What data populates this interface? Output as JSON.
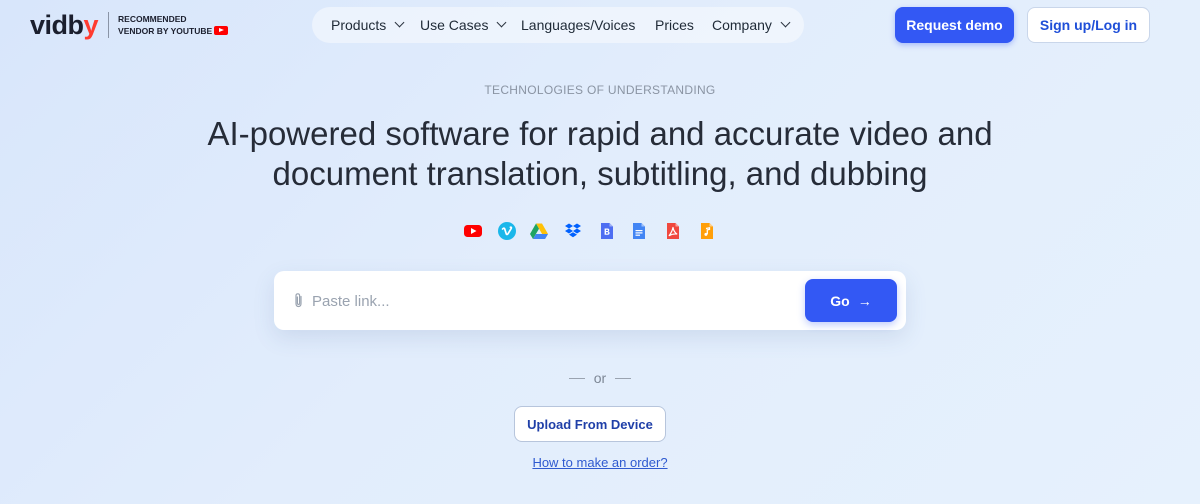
{
  "brand": {
    "logo_main": "vidb",
    "logo_accent": "y",
    "recommended_line1": "RECOMMENDED",
    "recommended_line2": "VENDOR BY YOUTUBE",
    "badge_icon": "youtube-icon"
  },
  "nav": {
    "items": [
      {
        "label": "Products",
        "dropdown": true
      },
      {
        "label": "Use Cases",
        "dropdown": true
      },
      {
        "label": "Languages/Voices",
        "dropdown": false
      },
      {
        "label": "Prices",
        "dropdown": false
      },
      {
        "label": "Company",
        "dropdown": true
      }
    ]
  },
  "header_actions": {
    "request_demo": "Request demo",
    "signup_login": "Sign up/Log in"
  },
  "hero": {
    "eyebrow": "TECHNOLOGIES OF UNDERSTANDING",
    "headline_line1": "AI-powered software for rapid and accurate video and",
    "headline_line2": "document translation, subtitling, and dubbing"
  },
  "sources": [
    {
      "icon": "youtube-icon",
      "color": "#ff0000"
    },
    {
      "icon": "vimeo-icon",
      "color": "#1ab7ea"
    },
    {
      "icon": "google-drive-icon",
      "color": "#1fa463"
    },
    {
      "icon": "dropbox-icon",
      "color": "#0061fe"
    },
    {
      "icon": "google-slides-docs-icon",
      "color": "#4e6ef2"
    },
    {
      "icon": "google-docs-icon",
      "color": "#4285f4"
    },
    {
      "icon": "pdf-icon",
      "color": "#f0483e"
    },
    {
      "icon": "audio-file-icon",
      "color": "#ff9f0a"
    }
  ],
  "link_form": {
    "placeholder": "Paste link...",
    "value": "",
    "go_label": "Go"
  },
  "divider_text": "or",
  "upload_label": "Upload From Device",
  "howto_link": "How to make an order?",
  "colors": {
    "accent": "#3358f4",
    "logo_accent": "#ff3b30",
    "link": "#2f5ad0"
  }
}
